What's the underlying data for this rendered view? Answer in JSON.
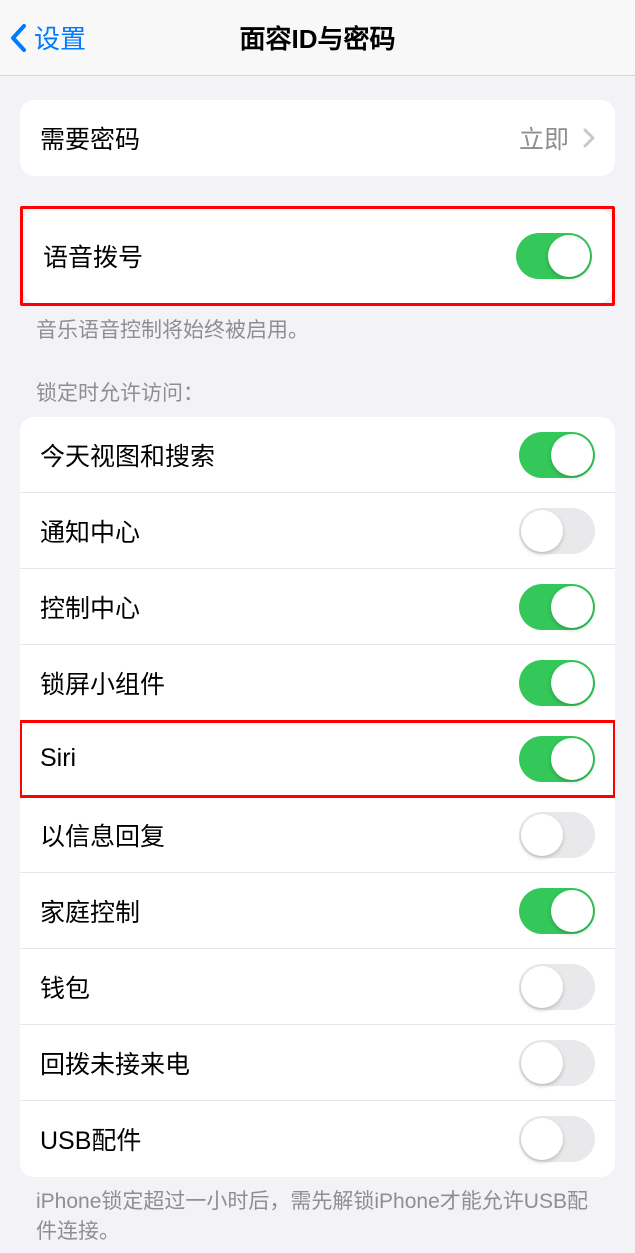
{
  "header": {
    "back_label": "设置",
    "title": "面容ID与密码"
  },
  "passcode_group": {
    "require_passcode": {
      "label": "需要密码",
      "value": "立即"
    }
  },
  "voice_dial": {
    "label": "语音拨号",
    "on": true,
    "footer": "音乐语音控制将始终被启用。"
  },
  "lock_access": {
    "header": "锁定时允许访问：",
    "items": [
      {
        "label": "今天视图和搜索",
        "on": true
      },
      {
        "label": "通知中心",
        "on": false
      },
      {
        "label": "控制中心",
        "on": true
      },
      {
        "label": "锁屏小组件",
        "on": true
      },
      {
        "label": "Siri",
        "on": true
      },
      {
        "label": "以信息回复",
        "on": false
      },
      {
        "label": "家庭控制",
        "on": true
      },
      {
        "label": "钱包",
        "on": false
      },
      {
        "label": "回拨未接来电",
        "on": false
      },
      {
        "label": "USB配件",
        "on": false
      }
    ],
    "footer": "iPhone锁定超过一小时后，需先解锁iPhone才能允许USB配件连接。"
  }
}
